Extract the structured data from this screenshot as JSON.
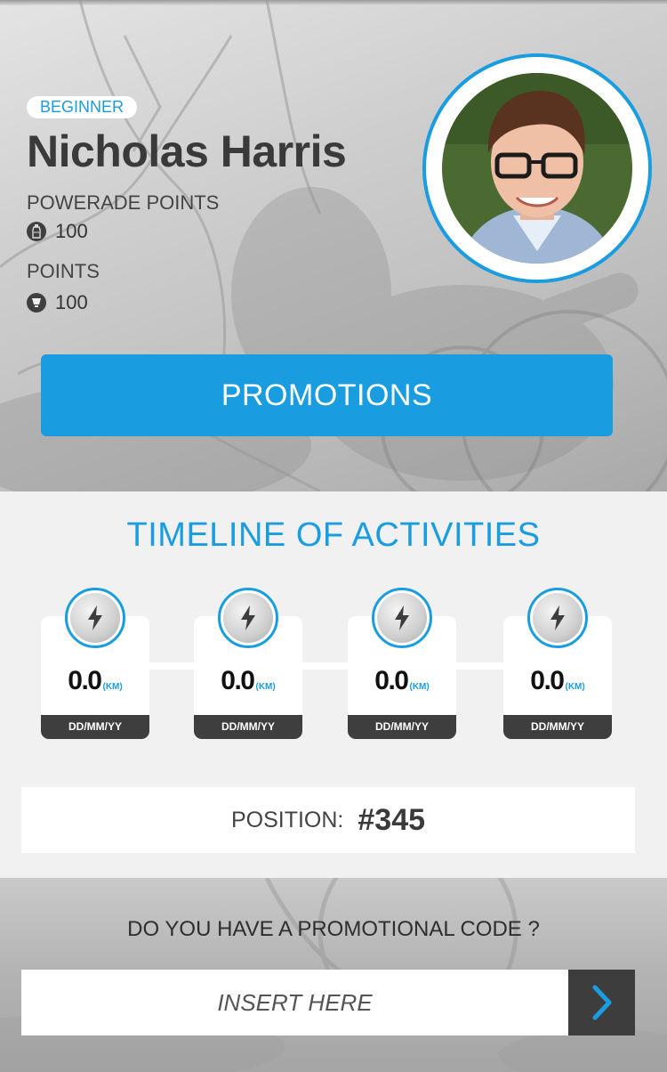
{
  "profile": {
    "level": "BEGINNER",
    "name": "Nicholas Harris",
    "powerade_label": "POWERADE POINTS",
    "powerade_value": "100",
    "points_label": "POINTS",
    "points_value": "100"
  },
  "actions": {
    "promotions": "PROMOTIONS"
  },
  "timeline": {
    "title": "TIMELINE OF ACTIVITIES",
    "unit": "(KM)",
    "items": [
      {
        "distance": "0.0",
        "date": "DD/MM/YY"
      },
      {
        "distance": "0.0",
        "date": "DD/MM/YY"
      },
      {
        "distance": "0.0",
        "date": "DD/MM/YY"
      },
      {
        "distance": "0.0",
        "date": "DD/MM/YY"
      }
    ]
  },
  "position": {
    "label": "POSITION:",
    "value": "#345"
  },
  "promo_code": {
    "question": "DO YOU HAVE A PROMOTIONAL CODE ?",
    "placeholder": "INSERT HERE"
  },
  "colors": {
    "accent": "#1a9de0",
    "dark": "#3d3d3d"
  },
  "icons": [
    "bottle-icon",
    "trophy-icon",
    "lightning-icon",
    "chevron-right-icon"
  ]
}
